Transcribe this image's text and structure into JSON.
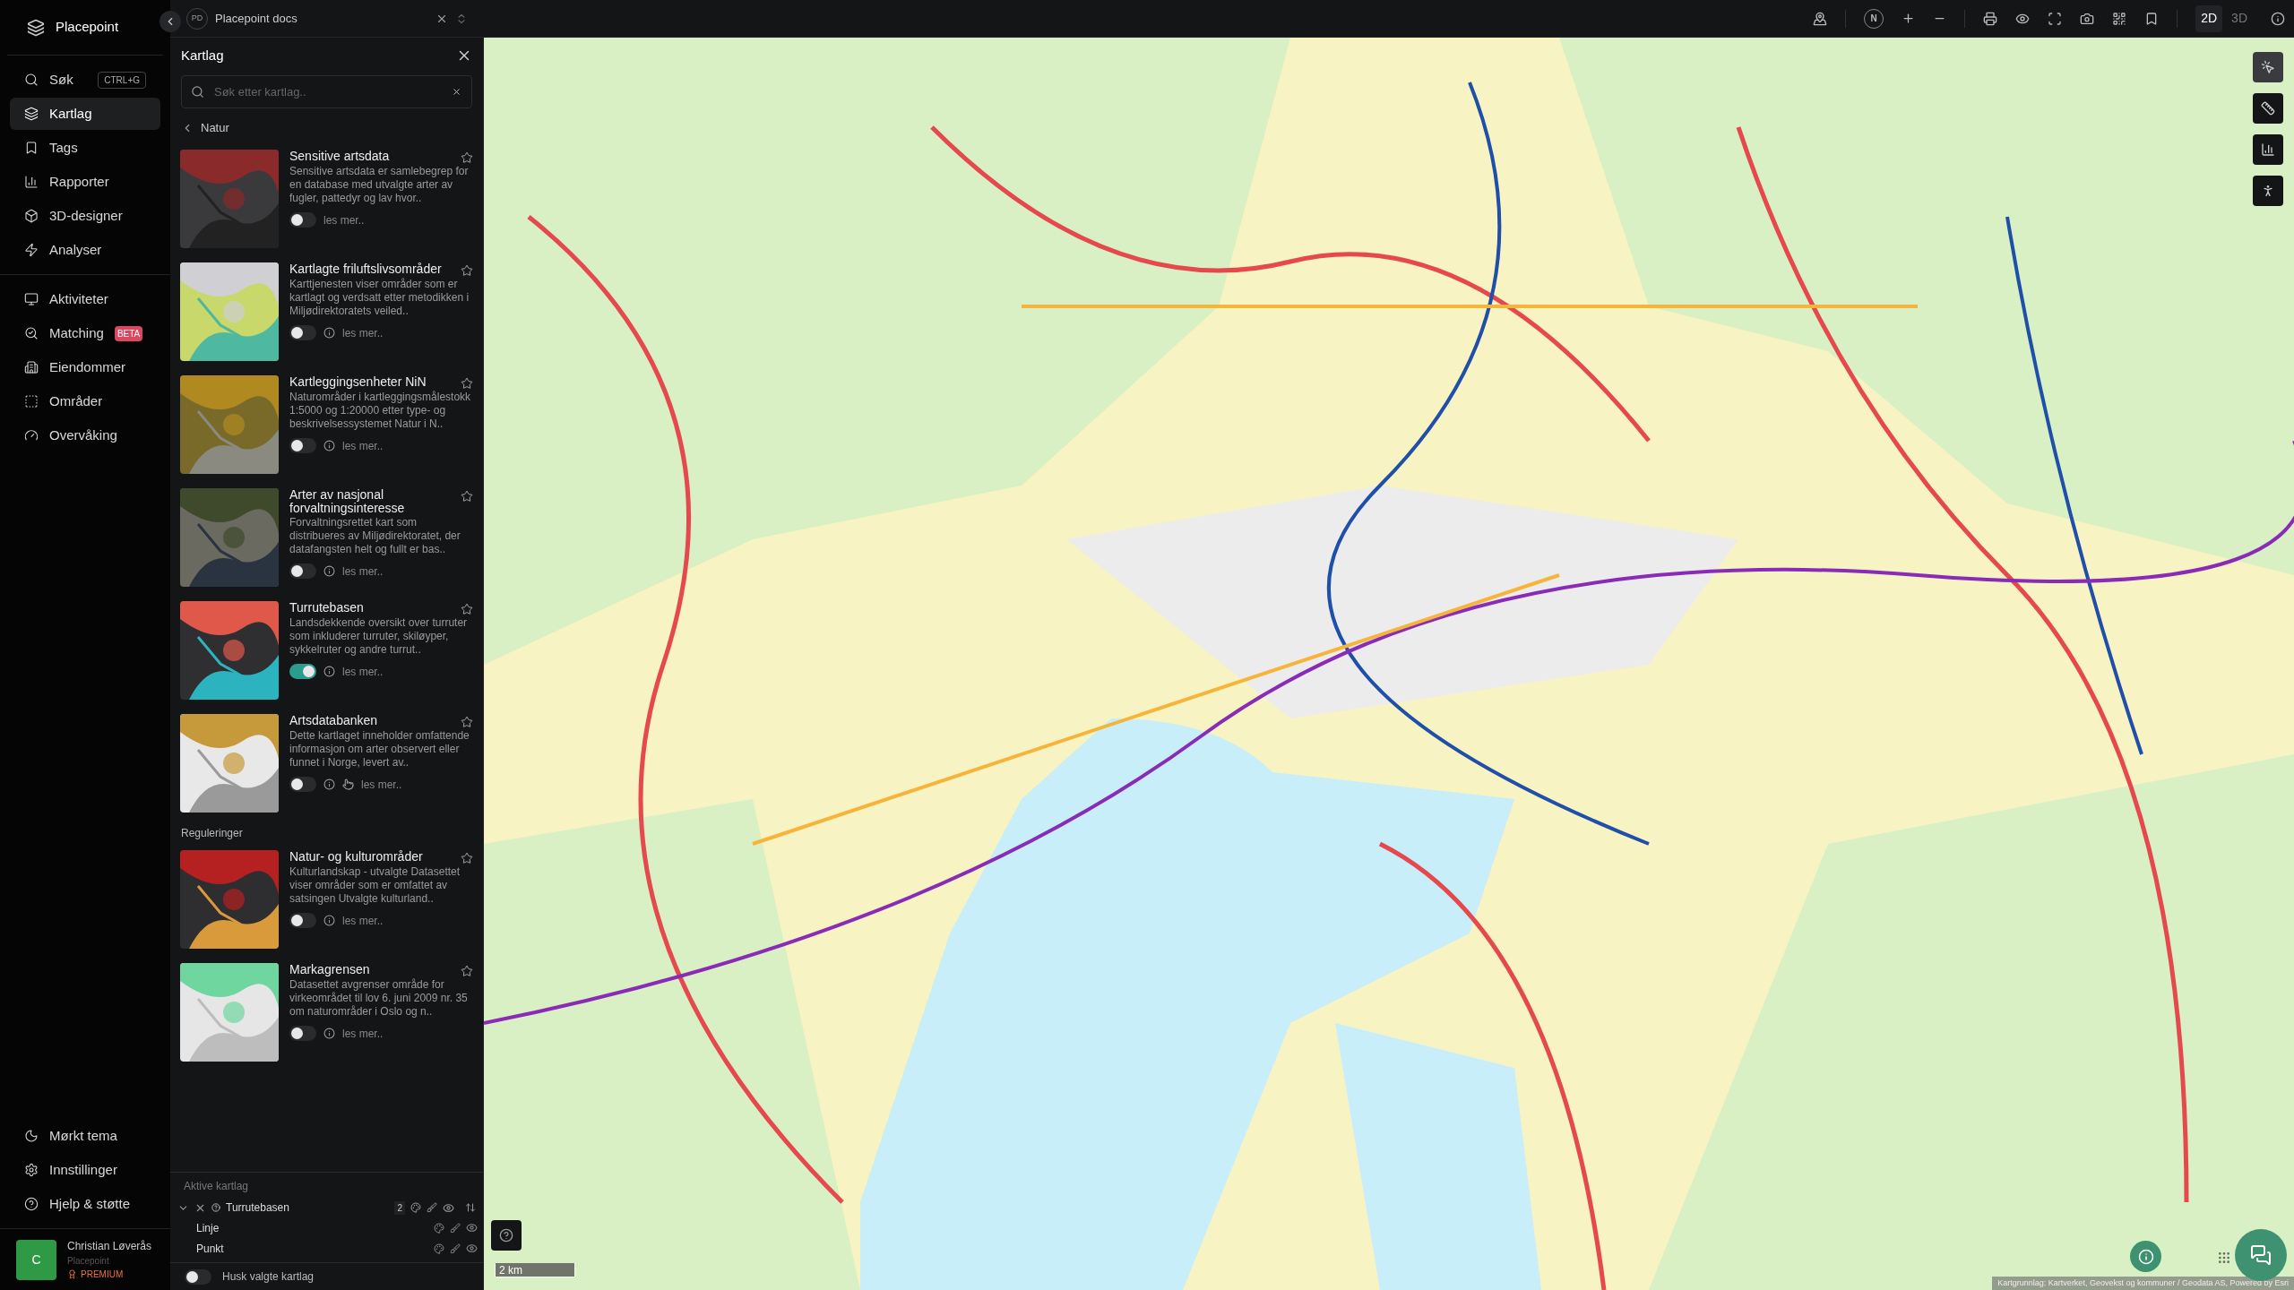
{
  "brand": {
    "name": "Placepoint"
  },
  "nav_main": [
    {
      "label": "Søk",
      "shortcut": "CTRL+G",
      "selected": false
    },
    {
      "label": "Kartlag",
      "selected": true
    },
    {
      "label": "Tags",
      "selected": false
    },
    {
      "label": "Rapporter",
      "selected": false
    },
    {
      "label": "3D-designer",
      "selected": false
    },
    {
      "label": "Analyser",
      "selected": false
    }
  ],
  "nav_tools": [
    {
      "label": "Aktiviteter",
      "selected": false
    },
    {
      "label": "Matching",
      "badge": "BETA",
      "selected": false
    },
    {
      "label": "Eiendommer",
      "selected": false
    },
    {
      "label": "Områder",
      "selected": false
    },
    {
      "label": "Overvåking",
      "selected": false
    }
  ],
  "nav_bottom": [
    {
      "label": "Mørkt tema"
    },
    {
      "label": "Innstillinger"
    },
    {
      "label": "Hjelp & støtte"
    }
  ],
  "user": {
    "initial": "C",
    "name": "Christian Løverås",
    "org": "Placepoint",
    "plan": "PREMIUM"
  },
  "tab": {
    "initials": "PD",
    "title": "Placepoint docs"
  },
  "panel": {
    "title": "Kartlag",
    "search": {
      "placeholder": "Søk etter kartlag.."
    },
    "back_label": "Natur",
    "sections": [
      {
        "layers": [
          {
            "title": "Sensitive artsdata",
            "description": "Sensitive artsdata er samlebegrep for en database med utvalgte arter av fugler, pattedyr og lav hvor..",
            "on": false,
            "info": false,
            "hand": false,
            "more": "les mer.."
          },
          {
            "title": "Kartlagte friluftslivsområder",
            "description": "Karttjenesten viser områder som er kartlagt og verdsatt etter metodikken i Miljødirektoratets veiled..",
            "on": false,
            "info": true,
            "hand": false,
            "more": "les mer.."
          },
          {
            "title": "Kartleggingsenheter NiN",
            "description": "Naturområder i kartleggingsmålestokk 1:5000 og 1:20000 etter type- og beskrivelsessystemet Natur i N..",
            "on": false,
            "info": true,
            "hand": false,
            "more": "les mer.."
          },
          {
            "title": "Arter av nasjonal forvaltningsinteresse",
            "description": "Forvaltningsrettet kart som distribueres av Miljødirektoratet, der datafangsten helt og fullt er bas..",
            "on": false,
            "info": true,
            "hand": false,
            "more": "les mer.."
          },
          {
            "title": "Turrutebasen",
            "description": "Landsdekkende oversikt over turruter som inkluderer turruter, skiløyper, sykkelruter og andre turrut..",
            "on": true,
            "info": true,
            "hand": false,
            "more": "les mer.."
          },
          {
            "title": "Artsdatabanken",
            "description": "Dette kartlaget inneholder omfattende informasjon om arter observert eller funnet i Norge, levert av..",
            "on": false,
            "info": true,
            "hand": true,
            "more": "les mer.."
          }
        ]
      },
      {
        "heading": "Reguleringer",
        "layers": [
          {
            "title": "Natur- og kulturområder",
            "description": "Kulturlandskap - utvalgte Datasettet viser områder som er omfattet av satsingen Utvalgte kulturland..",
            "on": false,
            "info": true,
            "hand": false,
            "more": "les mer.."
          },
          {
            "title": "Markagrensen",
            "description": "Datasettet avgrenser område for virkeområdet til lov 6. juni 2009 nr. 35 om naturområder i Oslo og n..",
            "on": false,
            "info": true,
            "hand": false,
            "more": "les mer.."
          }
        ]
      }
    ],
    "active": {
      "heading": "Aktive kartlag",
      "groups": [
        {
          "title": "Turrutebasen",
          "count": "2",
          "expanded": true,
          "children": [
            {
              "title": "Linje"
            },
            {
              "title": "Punkt"
            }
          ]
        }
      ]
    },
    "remember": {
      "label": "Husk valgte kartlag",
      "on": false
    }
  },
  "toolbar": {
    "compass": "N",
    "modes": [
      {
        "label": "2D",
        "selected": true
      },
      {
        "label": "3D",
        "selected": false
      }
    ]
  },
  "map": {
    "scale": "2 km",
    "attribution": "Kartgrunnlag: Kartverket, Geovekst og kommuner / Geodata AS, Powered by Esri"
  }
}
